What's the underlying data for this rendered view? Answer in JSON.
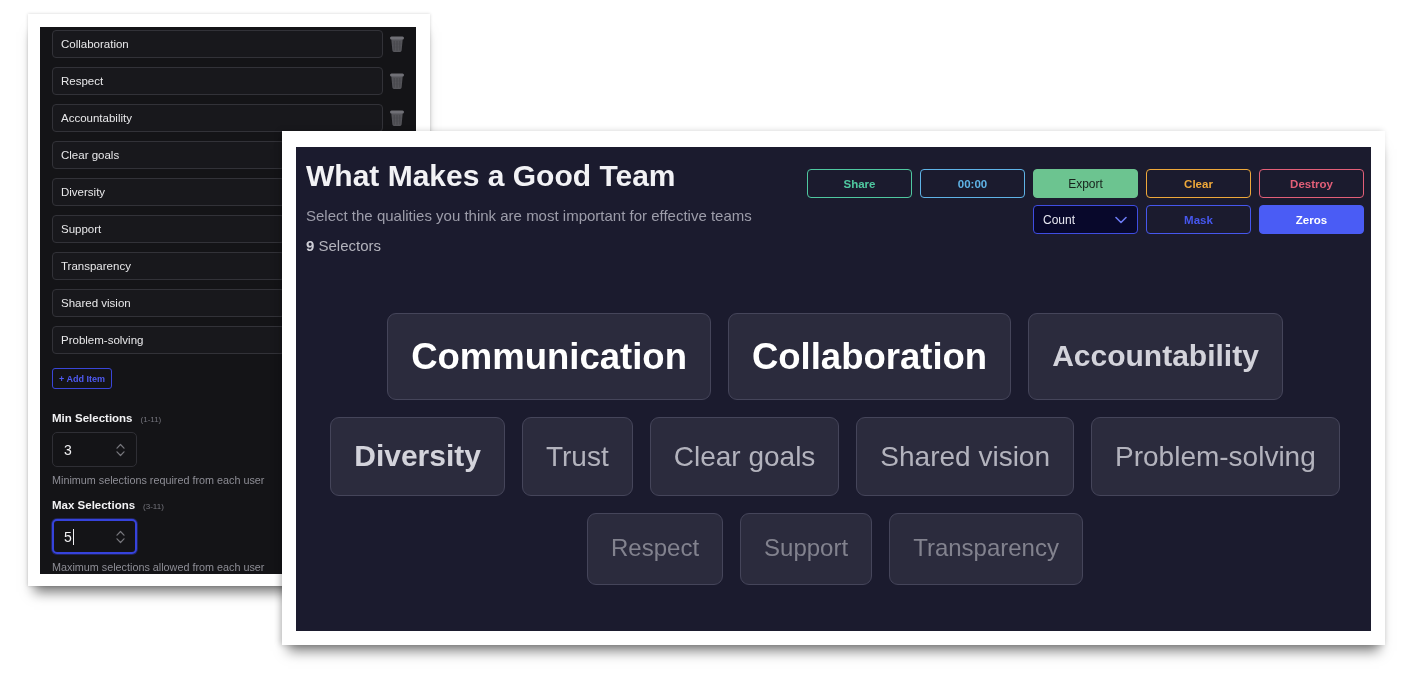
{
  "editor": {
    "items": [
      "Collaboration",
      "Respect",
      "Accountability",
      "Clear goals",
      "Diversity",
      "Support",
      "Transparency",
      "Shared vision",
      "Problem-solving"
    ],
    "add_button": "+ Add Item",
    "settings": [
      {
        "label": "Min Selections",
        "range": "(1-11)",
        "value": "3",
        "focused": false,
        "help": "Minimum selections required from each user"
      },
      {
        "label": "Max Selections",
        "range": "(3-11)",
        "value": "5",
        "focused": true,
        "help": "Maximum selections allowed from each user"
      }
    ]
  },
  "board": {
    "title": "What Makes a Good Team",
    "subtitle": "Select the qualities you think are most important for effective teams",
    "selector_count": "**9** Selectors",
    "toolbar": [
      [
        {
          "kind": "outline",
          "label": "Share",
          "color": "#4fc8a0"
        },
        {
          "kind": "outline",
          "label": "00:00",
          "color": "#5fb3e6"
        },
        {
          "kind": "filled",
          "label": "Export",
          "color": "#6cc490"
        },
        {
          "kind": "outline",
          "label": "Clear",
          "color": "#eea83a"
        },
        {
          "kind": "outline",
          "label": "Destroy",
          "color": "#e35f78"
        }
      ],
      [
        {
          "kind": "dropdown",
          "label": "Count",
          "color": "#3f4de2"
        },
        {
          "kind": "outline",
          "label": "Mask",
          "color": "#4657ee"
        },
        {
          "kind": "filled",
          "label": "Zeros",
          "color": "#4a5cf5"
        }
      ]
    ],
    "options": [
      {
        "label": "Communication",
        "bold": true,
        "highlighted": true,
        "dimmed": false
      },
      {
        "label": "Collaboration",
        "bold": true,
        "highlighted": true,
        "dimmed": false
      },
      {
        "label": "Accountability",
        "bold": true,
        "highlighted": false,
        "dimmed": false
      },
      {
        "label": "Diversity",
        "bold": true,
        "highlighted": false,
        "dimmed": false
      },
      {
        "label": "Trust",
        "bold": false,
        "highlighted": false,
        "dimmed": false
      },
      {
        "label": "Clear goals",
        "bold": false,
        "highlighted": false,
        "dimmed": false
      },
      {
        "label": "Shared vision",
        "bold": false,
        "highlighted": false,
        "dimmed": false
      },
      {
        "label": "Problem-solving",
        "bold": false,
        "highlighted": false,
        "dimmed": false
      },
      {
        "label": "Respect",
        "bold": false,
        "highlighted": false,
        "dimmed": true
      },
      {
        "label": "Support",
        "bold": false,
        "highlighted": false,
        "dimmed": true
      },
      {
        "label": "Transparency",
        "bold": false,
        "highlighted": false,
        "dimmed": true
      }
    ]
  }
}
